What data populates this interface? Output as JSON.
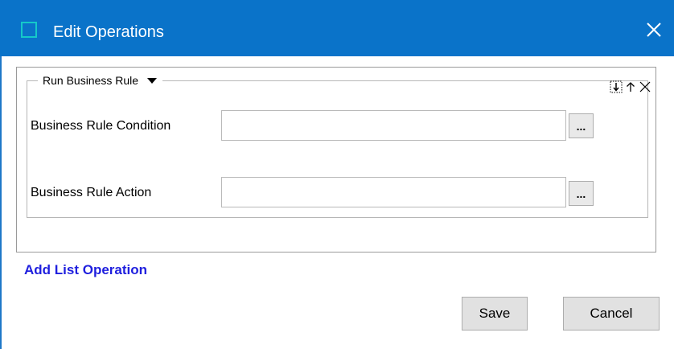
{
  "window": {
    "title": "Edit Operations",
    "titlebar_color": "#0a73c9",
    "icon": "app-window-icon",
    "close_icon": "close-icon"
  },
  "group": {
    "legend": "Run Business Rule",
    "legend_icon": "dropdown-caret-icon",
    "tools": [
      "insert-below-icon",
      "move-up-icon",
      "remove-icon"
    ]
  },
  "fields": {
    "condition": {
      "label": "Business Rule Condition",
      "value": "",
      "browse_label": "..."
    },
    "action": {
      "label": "Business Rule Action",
      "value": "",
      "browse_label": "..."
    }
  },
  "links": {
    "add_list_operation": "Add List Operation",
    "link_color": "#1f1fde"
  },
  "buttons": {
    "save": "Save",
    "cancel": "Cancel"
  }
}
